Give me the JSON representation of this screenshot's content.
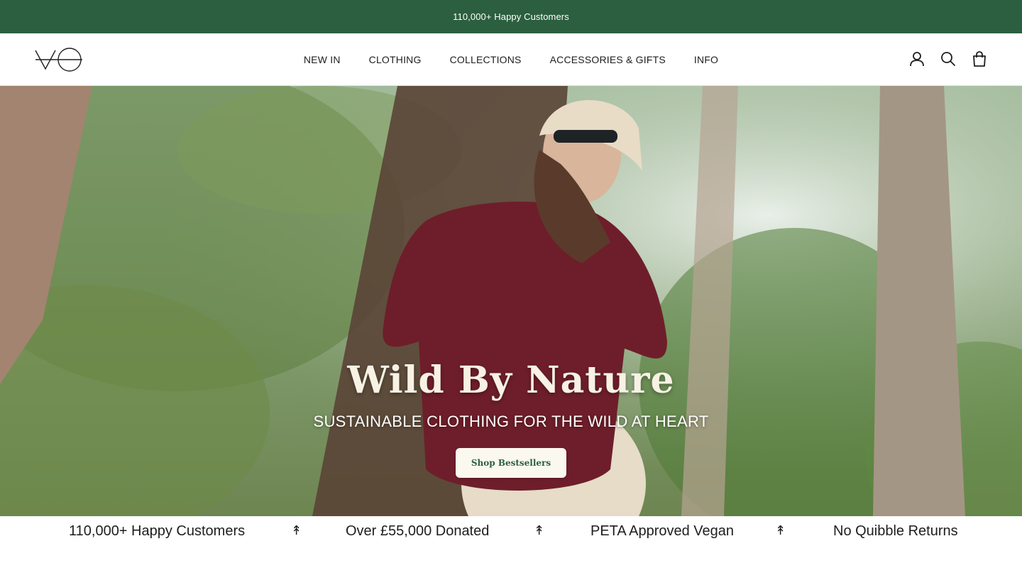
{
  "colors": {
    "brand": "#2b5f3f",
    "hero_title": "#f7f2e4",
    "cta_bg": "#fbf8ef"
  },
  "announcement": {
    "text": "110,000+ Happy Customers"
  },
  "header": {
    "logo_icon": "vo-logo-icon",
    "nav": [
      "NEW IN",
      "CLOTHING",
      "COLLECTIONS",
      "ACCESSORIES & GIFTS",
      "INFO"
    ],
    "icons": [
      "account-icon",
      "search-icon",
      "bag-icon"
    ]
  },
  "hero": {
    "title": "Wild By Nature",
    "subtitle": "SUSTAINABLE CLOTHING FOR THE WILD AT HEART",
    "cta": "Shop Bestsellers"
  },
  "usp": {
    "items": [
      "110,000+ Happy Customers",
      "Over £55,000 Donated",
      "PETA Approved Vegan",
      "No Quibble Returns"
    ],
    "separator": "↟"
  }
}
